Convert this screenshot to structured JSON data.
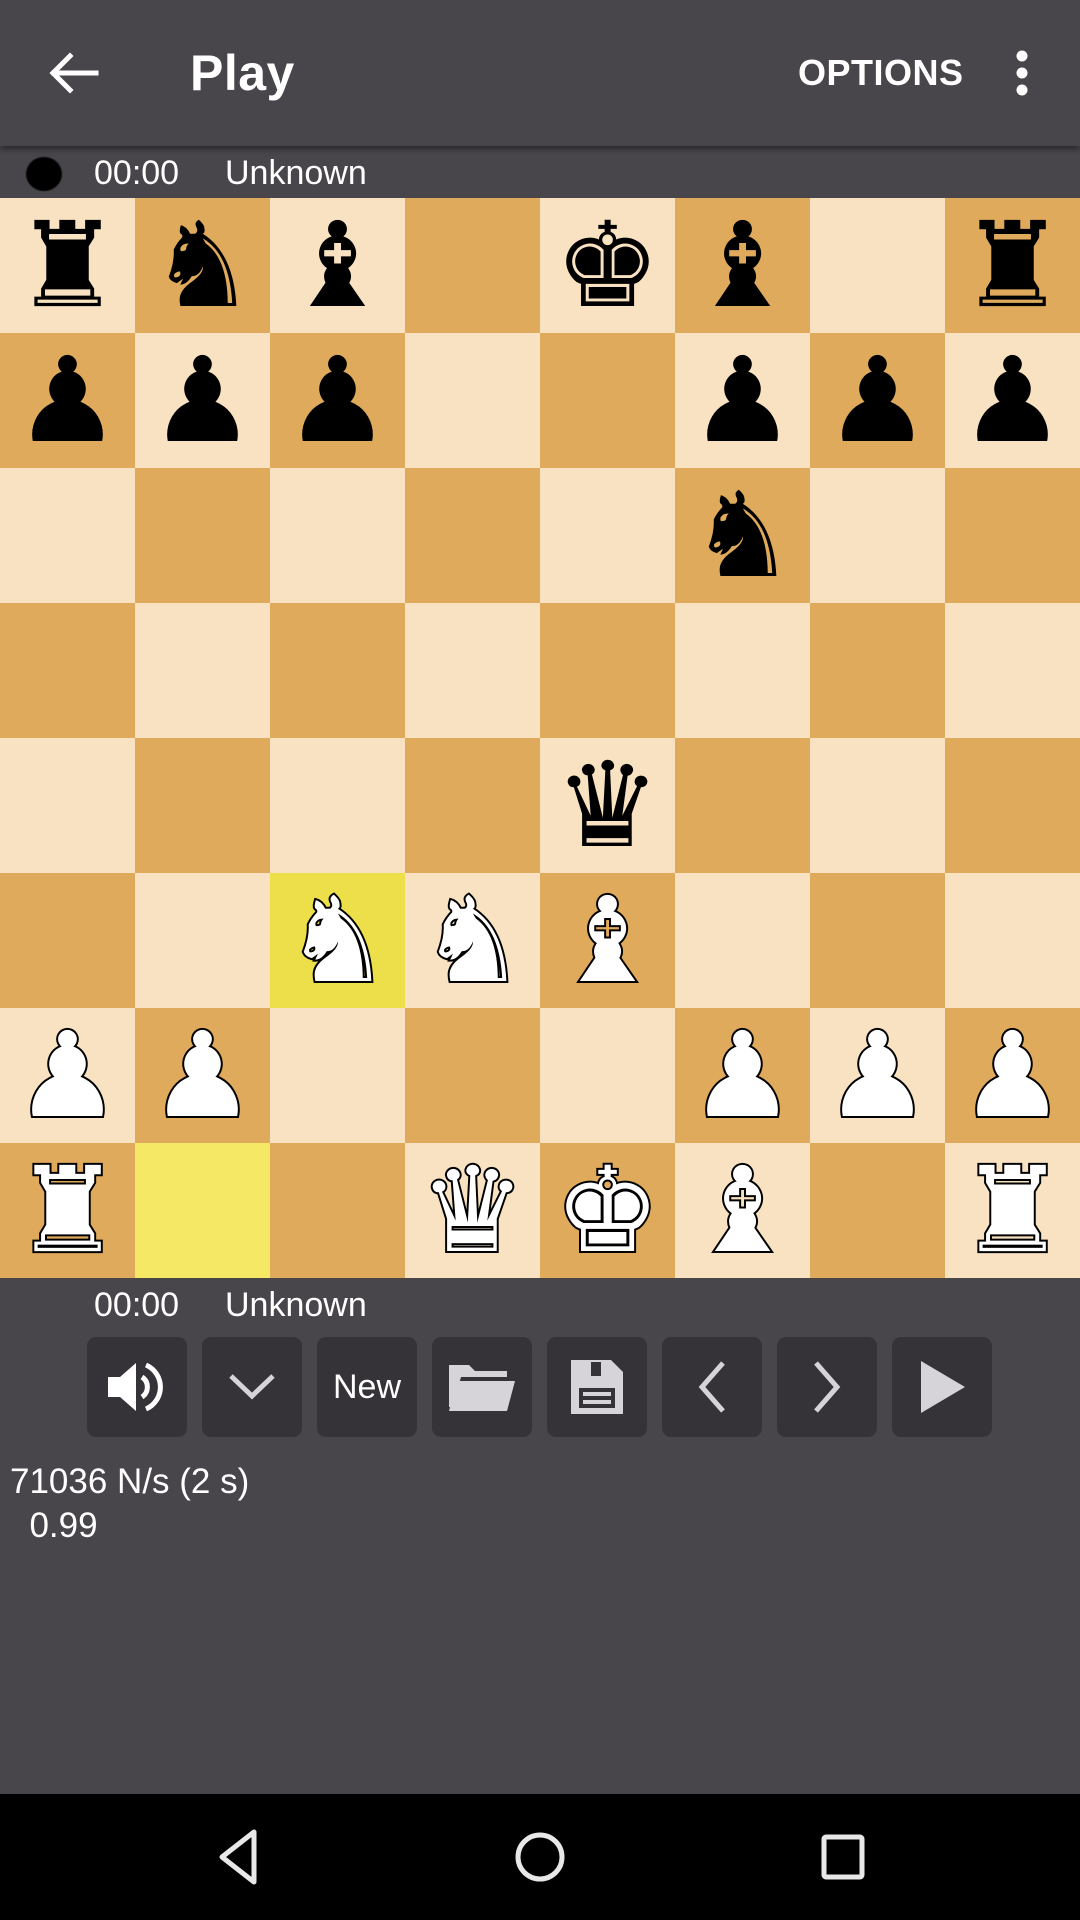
{
  "appbar": {
    "back_icon": "arrow-left-icon",
    "title": "Play",
    "options_label": "OPTIONS",
    "more_icon": "more-vert-icon"
  },
  "players": {
    "top": {
      "clock": "00:00",
      "name": "Unknown",
      "to_move": true,
      "side": "black"
    },
    "bottom": {
      "clock": "00:00",
      "name": "Unknown",
      "to_move": false,
      "side": "white"
    }
  },
  "board": {
    "colors": {
      "light": "#f9e2c1",
      "dark": "#e0aa5c",
      "highlight_from": "#f4e864",
      "highlight_to": "#ecdf4a"
    },
    "orientation": "white-bottom",
    "ranks": [
      [
        "r",
        "n",
        "b",
        "",
        "k",
        "b",
        "",
        "r"
      ],
      [
        "p",
        "p",
        "p",
        "",
        "",
        "p",
        "p",
        "p"
      ],
      [
        "",
        "",
        "",
        "",
        "",
        "n",
        "",
        ""
      ],
      [
        "",
        "",
        "",
        "",
        "",
        "",
        "",
        ""
      ],
      [
        "",
        "",
        "",
        "",
        "q",
        "",
        "",
        ""
      ],
      [
        "",
        "",
        "N",
        "N",
        "B",
        "",
        "",
        ""
      ],
      [
        "P",
        "P",
        "",
        "",
        "",
        "P",
        "P",
        "P"
      ],
      [
        "R",
        "",
        "",
        "Q",
        "K",
        "B",
        "",
        "R"
      ]
    ],
    "last_move": {
      "from": "b1",
      "to": "c3"
    }
  },
  "toolbar": {
    "buttons": [
      {
        "name": "sound-button",
        "icon": "volume-icon",
        "label": ""
      },
      {
        "name": "mode-dropdown-button",
        "icon": "chevron-down-icon",
        "label": ""
      },
      {
        "name": "new-game-button",
        "icon": "",
        "label": "New"
      },
      {
        "name": "load-button",
        "icon": "folder-open-icon",
        "label": ""
      },
      {
        "name": "save-button",
        "icon": "floppy-disk-icon",
        "label": ""
      },
      {
        "name": "undo-button",
        "icon": "chevron-left-icon",
        "label": ""
      },
      {
        "name": "redo-button",
        "icon": "chevron-right-icon",
        "label": ""
      },
      {
        "name": "play-button",
        "icon": "play-icon",
        "label": ""
      }
    ]
  },
  "engine": {
    "speed_line": "71036 N/s (2 s)",
    "eval_line": "  0.99"
  },
  "navbar": {
    "back_icon": "nav-back-icon",
    "home_icon": "nav-home-icon",
    "recents_icon": "nav-recents-icon"
  }
}
